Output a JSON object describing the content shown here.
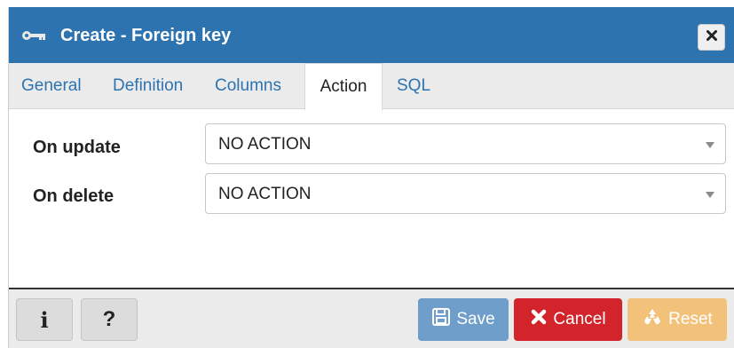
{
  "window": {
    "title": "Create - Foreign key",
    "title_icon": "key-icon",
    "close_icon": "close-icon"
  },
  "tabs": [
    {
      "label": "General",
      "active": false
    },
    {
      "label": "Definition",
      "active": false
    },
    {
      "label": "Columns",
      "active": false
    },
    {
      "label": "Action",
      "active": true
    },
    {
      "label": "SQL",
      "active": false
    }
  ],
  "form": {
    "on_update": {
      "label": "On update",
      "value": "NO ACTION"
    },
    "on_delete": {
      "label": "On delete",
      "value": "NO ACTION"
    }
  },
  "footer": {
    "info_label": "i",
    "help_label": "?",
    "save_label": "Save",
    "cancel_label": "Cancel",
    "reset_label": "Reset"
  },
  "colors": {
    "titlebar": "#2d73b0",
    "save": "#6e9ec9",
    "cancel": "#d3242b",
    "reset": "#f3c27a"
  }
}
